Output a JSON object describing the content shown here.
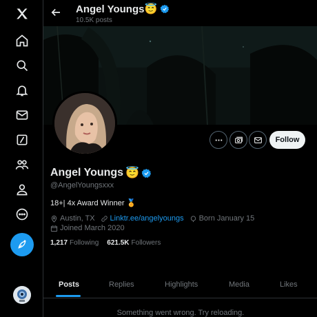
{
  "header": {
    "name": "Angel Youngs",
    "emoji": "😇",
    "posts": "10.5K posts"
  },
  "profile": {
    "name": "Angel Youngs",
    "emoji": "😇",
    "handle": "@AngelYoungsxxx",
    "bio": "18+| 4x Award Winner",
    "bio_emoji": "🏅",
    "location": "Austin, TX",
    "link": "Linktr.ee/angelyoungs",
    "born": "Born January 15",
    "joined": "Joined March 2020",
    "following_count": "1,217",
    "following_label": "Following",
    "followers_count": "621.5K",
    "followers_label": "Followers"
  },
  "actions": {
    "follow_label": "Follow"
  },
  "tabs": [
    {
      "label": "Posts"
    },
    {
      "label": "Replies"
    },
    {
      "label": "Highlights"
    },
    {
      "label": "Media"
    },
    {
      "label": "Likes"
    }
  ],
  "status": {
    "error": "Something went wrong. Try reloading."
  },
  "colors": {
    "accent": "#1d9bf0",
    "background": "#000000",
    "muted": "#71767b"
  },
  "sidebar": {
    "icons": [
      "x-logo-icon",
      "home-icon",
      "search-icon",
      "notifications-icon",
      "messages-icon",
      "grok-icon",
      "communities-icon",
      "profile-icon",
      "more-icon",
      "post-icon"
    ]
  }
}
